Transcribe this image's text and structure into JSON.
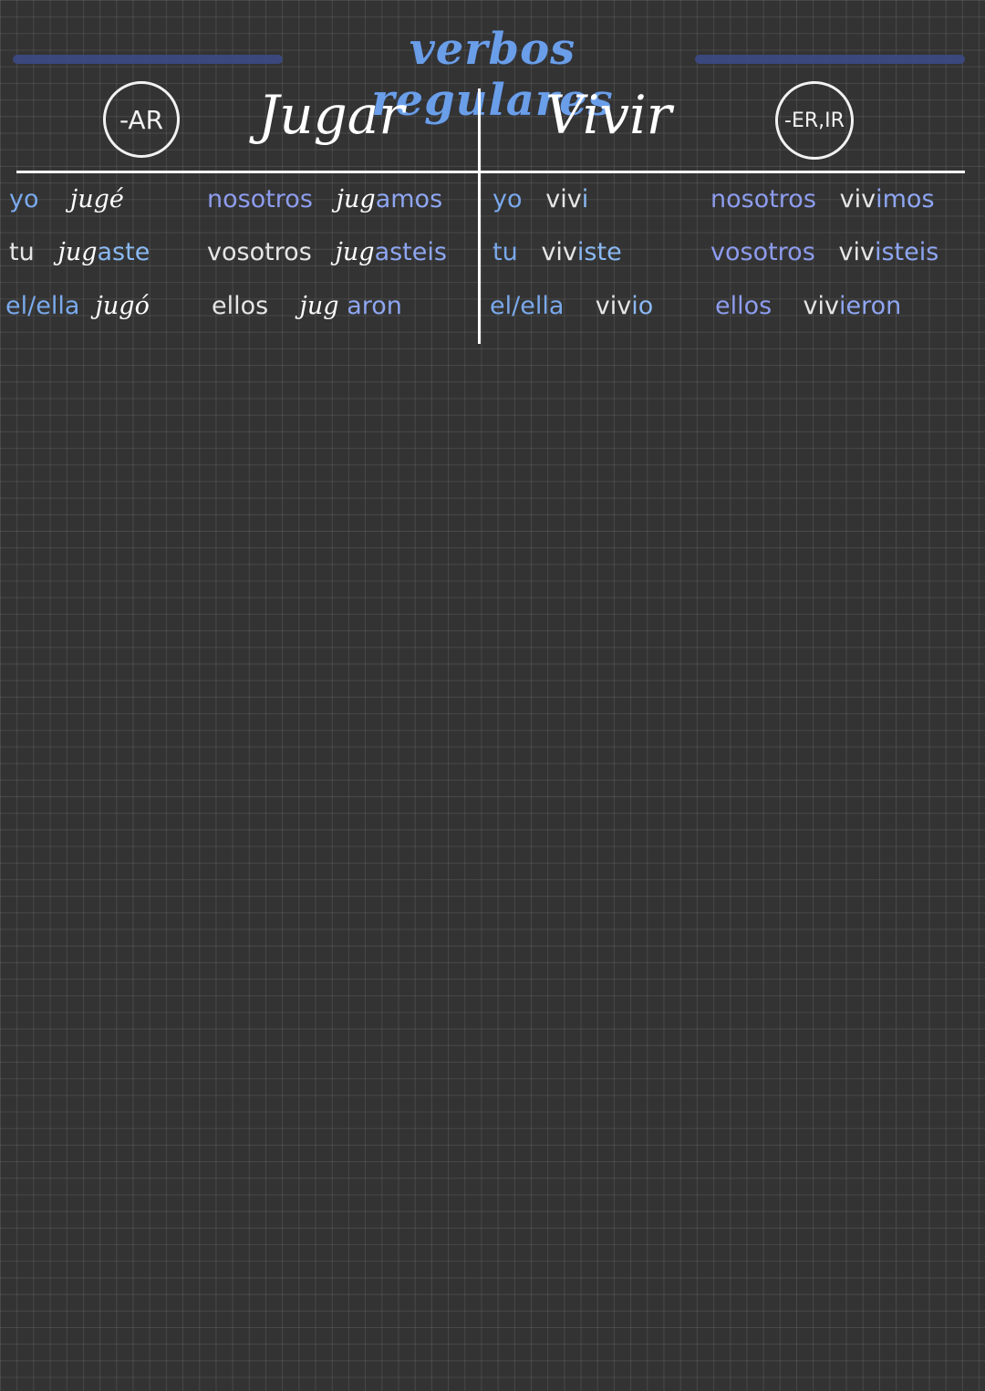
{
  "title": "verbos regulares",
  "colors": {
    "background": "#333333",
    "accent_blue": "#6a9ee8",
    "ending_violet": "#8ea6f2",
    "bar": "#3b4a86"
  },
  "badges": {
    "ar": "-AR",
    "er_ir": "-ER,IR"
  },
  "verbs": {
    "left": "Jugar",
    "right": "Vivir"
  },
  "jugar": {
    "rows": [
      {
        "pronoun": "yo",
        "stem": "jug",
        "ending": "é",
        "plural_pronoun": "nosotros",
        "plural_stem": "jug",
        "plural_ending": "amos"
      },
      {
        "pronoun": "tu",
        "stem": "jug",
        "ending": "aste",
        "plural_pronoun": "vosotros",
        "plural_stem": "jug",
        "plural_ending": "asteis"
      },
      {
        "pronoun": "el/ella",
        "stem": "jug",
        "ending": "ó",
        "plural_pronoun": "ellos",
        "plural_stem": "jug",
        "plural_ending": "aron"
      }
    ]
  },
  "vivir": {
    "rows": [
      {
        "pronoun": "yo",
        "stem": "viv",
        "ending": "i",
        "plural_pronoun": "nosotros",
        "plural_stem": "viv",
        "plural_ending": "imos"
      },
      {
        "pronoun": "tu",
        "stem": "viv",
        "ending": "iste",
        "plural_pronoun": "vosotros",
        "plural_stem": "viv",
        "plural_ending": "isteis"
      },
      {
        "pronoun": "el/ella",
        "stem": "viv",
        "ending": "io",
        "plural_pronoun": "ellos",
        "plural_stem": "viv",
        "plural_ending": "ieron"
      }
    ]
  }
}
